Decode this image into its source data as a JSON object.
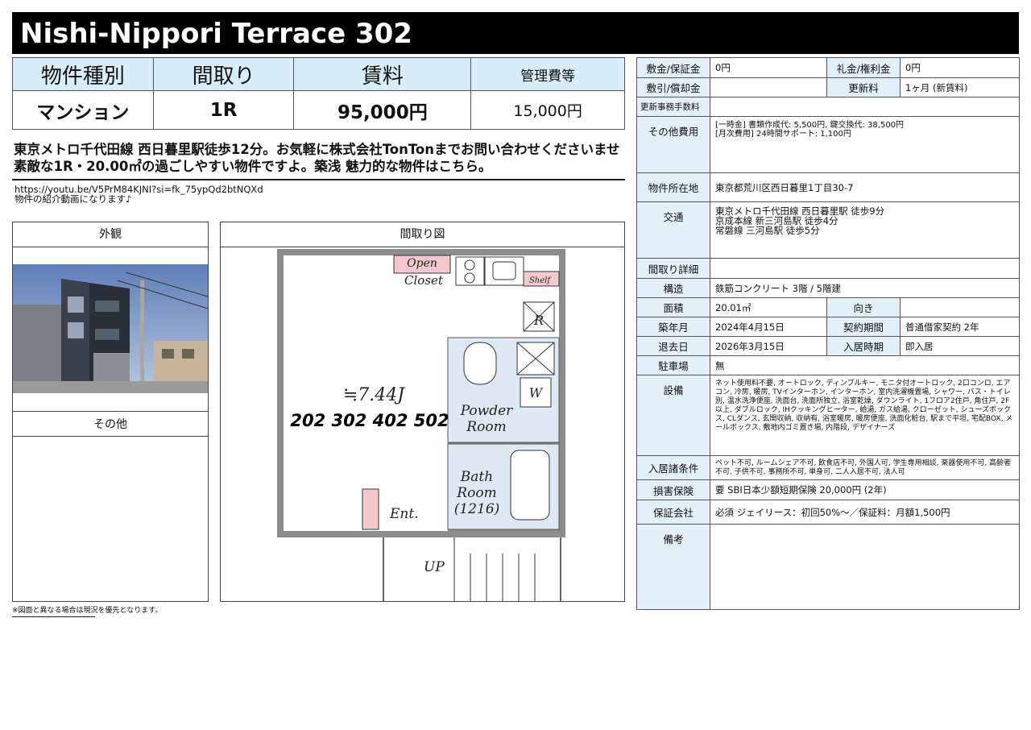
{
  "title": "Nishi-Nippori Terrace 302",
  "summary": {
    "headers": [
      "物件種別",
      "間取り",
      "賃料",
      "管理費等"
    ],
    "values": [
      "マンション",
      "1R",
      "95,000円",
      "15,000円"
    ]
  },
  "description": "東京メトロ千代田線 西日暮里駅徒歩12分。お気軽に株式会社TonTonまでお問い合わせくださいませ 素敵な1R・20.00㎡の過ごしやすい物件ですよ。築浅 魅力的な物件はこちら。",
  "video": {
    "url": "https://youtu.be/V5PrM84KJNI?si=fk_75ypQd2btNQXd",
    "note": "物件の紹介動画になります♪"
  },
  "panels": {
    "exterior": "外観",
    "other": "その他",
    "floorplan": "間取り図"
  },
  "floorplan": {
    "closet": [
      "Open",
      "Closet"
    ],
    "shelf": "Shelf",
    "r": "R",
    "w": "W",
    "size": "≒7.44J",
    "room_numbers": "202 302 402 502",
    "powder": [
      "Powder",
      "Room"
    ],
    "bath": [
      "Bath",
      "Room",
      "(1216)"
    ],
    "entrance": "Ent.",
    "up": "UP"
  },
  "footnote": "※図面と異なる場合は現況を優先となります。",
  "details": {
    "deposit_label": "敷金/保証金",
    "deposit": "0円",
    "key_money_label": "礼金/権利金",
    "key_money": "0円",
    "deduction_label": "敷引/償却金",
    "deduction": "",
    "renewal_label": "更新料",
    "renewal": "1ヶ月 (新賃料)",
    "renewal_fee_label": "更新事務手数料",
    "renewal_fee": "",
    "other_costs_label": "その他費用",
    "other_costs": [
      "[一時金] 書類作成代: 5,500円, 鍵交換代: 38,500円",
      "[月次費用] 24時間サポート: 1,100円"
    ],
    "address_label": "物件所在地",
    "address": "東京都荒川区西日暮里1丁目30-7",
    "transport_label": "交通",
    "transport": [
      "東京メトロ千代田線 西日暮里駅 徒歩9分",
      "京成本線 新三河島駅 徒歩4分",
      "常磐線 三河島駅 徒歩5分"
    ],
    "layout_detail_label": "間取り詳細",
    "layout_detail": "",
    "structure_label": "構造",
    "structure": "鉄筋コンクリート 3階 / 5階建",
    "area_label": "面積",
    "area": "20.01㎡",
    "direction_label": "向き",
    "direction": "",
    "built_label": "築年月",
    "built": "2024年4月15日",
    "contract_label": "契約期間",
    "contract": "普通借家契約 2年",
    "vacate_label": "退去日",
    "vacate": "2026年3月15日",
    "move_in_label": "入居時期",
    "move_in": "即入居",
    "parking_label": "駐車場",
    "parking": "無",
    "facilities_label": "設備",
    "facilities": "ネット使用料不要, オートロック, ディンプルキー, モニタ付オートロック, 2口コンロ, エアコン, 冷房, 暖房, TVインターホン, インターホン, 室内洗濯機置場, シャワー, バス・トイレ別, 温水洗浄便座, 洗面台, 洗面所独立, 浴室乾燥, ダウンライト, 1フロア2住戸, 角住戸, 2F以上, ダブルロック, IHクッキングヒーター, 給湯, ガス給湯, クローゼット, シューズボックス, CLダンス, 玄関収納, 収納有, 浴室暖房, 暖房便座, 洗面化粧台, 駅まで平坦, 宅配BOX, メールボックス, 敷地内ゴミ置き場, 内階段, デザイナーズ",
    "conditions_label": "入居諸条件",
    "conditions": "ペット不可, ルームシェア不可, 飲食店不可, 外国人可, 学生専用相談, 楽器使用不可, 高齢者不可, 子供不可, 事務所不可, 単身可, 二人入居不可, 法人可",
    "insurance_label": "損害保険",
    "insurance": "要 SBI日本少額短期保険 20,000円 (2年)",
    "guarantor_label": "保証会社",
    "guarantor": "必須 ジェイリース：初回50%～／保証料：月額1,500円",
    "remarks_label": "備考",
    "remarks": ""
  }
}
